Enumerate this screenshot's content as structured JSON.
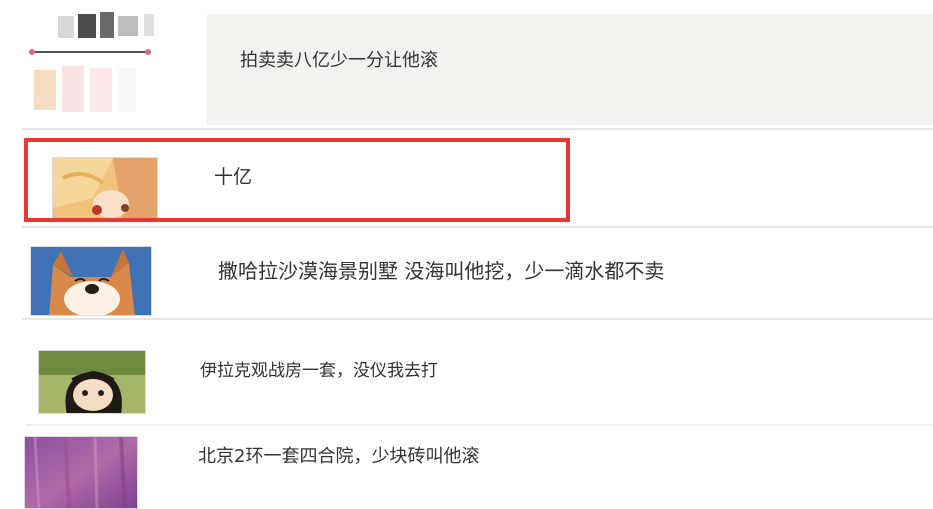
{
  "thread": {
    "replies": [
      {
        "author_avatar": "avatar-blurred-icon",
        "text": "拍卖卖八亿少一分让他滚"
      },
      {
        "author_avatar": "avatar-anime-girl-icon",
        "text": "十亿"
      },
      {
        "author_avatar": "avatar-shiba-dog-icon",
        "text": "撒哈拉沙漠海景别墅 没海叫他挖，少一滴水都不卖"
      },
      {
        "author_avatar": "avatar-anime-character-icon",
        "text": "伊拉克观战房一套，没仪我去打"
      },
      {
        "author_avatar": "avatar-purple-texture-icon",
        "text": "北京2环一套四合院，少块砖叫他滚"
      }
    ]
  },
  "highlight": {
    "color": "#e53935"
  },
  "colors": {
    "first_row_bg": "#f3f2ee",
    "text": "#333333",
    "separator": "#e6e6e6"
  }
}
